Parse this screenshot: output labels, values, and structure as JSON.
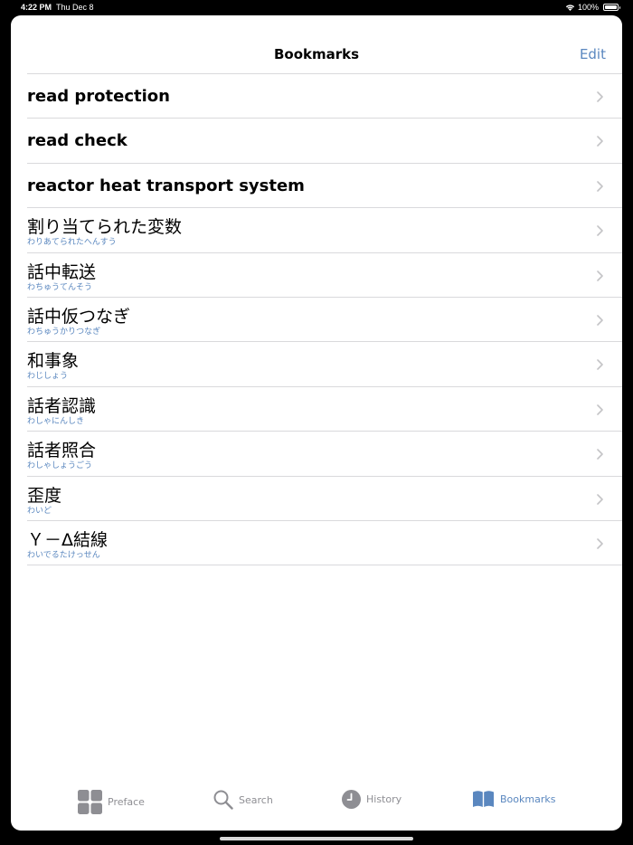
{
  "status_bar": {
    "time": "4:22 PM",
    "date": "Thu Dec 8",
    "battery": "100%",
    "icons": [
      "wifi-icon",
      "battery-icon"
    ]
  },
  "nav": {
    "title": "Bookmarks",
    "edit_label": "Edit"
  },
  "bookmarks": [
    {
      "term": "read protection",
      "reading": ""
    },
    {
      "term": "read check",
      "reading": ""
    },
    {
      "term": "reactor heat transport system",
      "reading": ""
    },
    {
      "term": "割り当てられた変数",
      "reading": "わりあてられたへんすう"
    },
    {
      "term": "話中転送",
      "reading": "わちゅうてんそう"
    },
    {
      "term": "話中仮つなぎ",
      "reading": "わちゅうかりつなぎ"
    },
    {
      "term": "和事象",
      "reading": "わじしょう"
    },
    {
      "term": "話者認識",
      "reading": "わしゃにんしき"
    },
    {
      "term": "話者照合",
      "reading": "わしゃしょうごう"
    },
    {
      "term": "歪度",
      "reading": "わいど"
    },
    {
      "term": "Ｙ－Δ結線",
      "reading": "わいでるたけっせん"
    }
  ],
  "tabs": [
    {
      "label": "Preface",
      "icon": "grid-icon"
    },
    {
      "label": "Search",
      "icon": "search-icon"
    },
    {
      "label": "History",
      "icon": "clock-icon"
    },
    {
      "label": "Bookmarks",
      "icon": "book-icon"
    }
  ],
  "colors": {
    "accent": "#5a87bf",
    "inactive": "#8e8e93",
    "separator": "#d9d9dc"
  }
}
